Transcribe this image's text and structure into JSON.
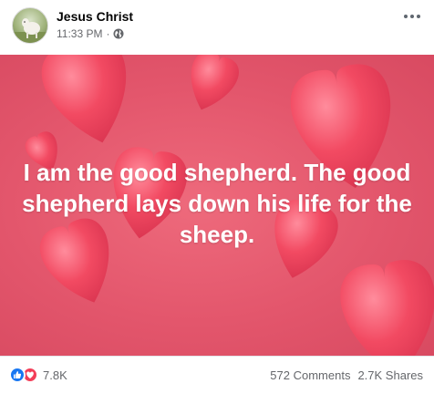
{
  "header": {
    "page_name": "Jesus Christ",
    "time": "11:33 PM",
    "separator": "·",
    "privacy_icon": "globe-icon",
    "more_icon": "more-options-icon"
  },
  "image": {
    "quote": "I am the good shepherd. The good shepherd lays down his life for the sheep.",
    "background_color": "#e3566c",
    "heart_color": "#f0475f"
  },
  "footer": {
    "reaction_icons": [
      "like-icon",
      "love-icon"
    ],
    "reaction_count": "7.8K",
    "comments": "572 Comments",
    "shares": "2.7K Shares"
  },
  "colors": {
    "like": "#1877f2",
    "love": "#f33e58",
    "secondary_text": "#65676b"
  }
}
